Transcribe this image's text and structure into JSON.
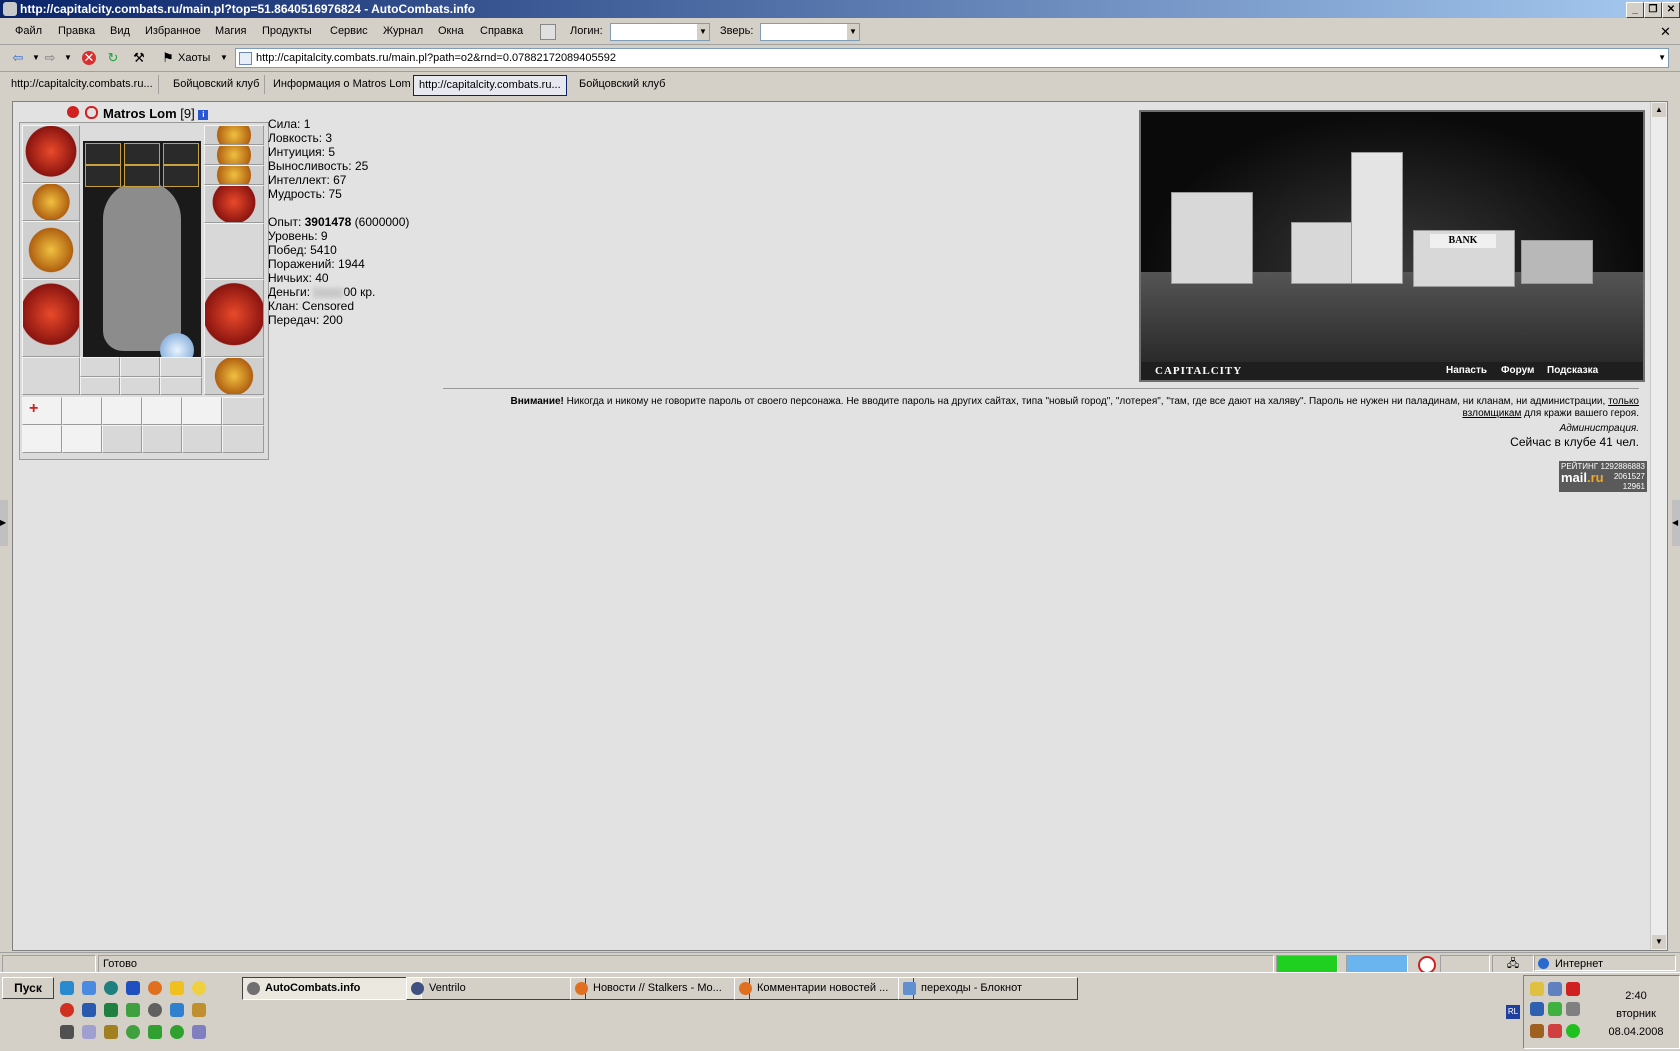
{
  "window": {
    "title": "http://capitalcity.combats.ru/main.pl?top=51.8640516976824 - AutoCombats.info"
  },
  "menu": {
    "items": [
      "Файл",
      "Правка",
      "Вид",
      "Избранное",
      "Магия",
      "Продукты",
      "Сервис",
      "Журнал",
      "Окна",
      "Справка"
    ],
    "login_label": "Логин:",
    "pet_label": "Зверь:"
  },
  "toolbar": {
    "chaos_label": "Хаоты",
    "address": "http://capitalcity.combats.ru/main.pl?path=o2&rnd=0.07882172089405592"
  },
  "tabs": [
    {
      "label": "http://capitalcity.combats.ru..."
    },
    {
      "label": "Бойцовский клуб"
    },
    {
      "label": "Информация о Matros Lom"
    },
    {
      "label": "http://capitalcity.combats.ru..."
    },
    {
      "label": "Бойцовский клуб"
    }
  ],
  "character": {
    "name": "Matros Lom",
    "level": "[9]",
    "info_badge": "i",
    "stats": [
      "Сила: 1",
      "Ловкость: 3",
      "Интуиция: 5",
      "Выносливость: 25",
      "Интеллект: 67",
      "Мудрость: 75"
    ],
    "experience_label": "Опыт: ",
    "experience_value": "3901478",
    "experience_next": " (6000000)",
    "info": [
      "Уровень: 9",
      "Побед: 5410",
      "Поражений: 1944",
      "Ничьих: 40"
    ],
    "money_label": "Деньги: ",
    "money_suffix": "00 кр.",
    "clan": "Клан: Censored",
    "transfers": "Передач: 200"
  },
  "city": {
    "brand": "CAPITALCITY",
    "bank_sign": "BANK",
    "links": [
      "Напасть",
      "Форум",
      "Подсказка"
    ]
  },
  "warning": {
    "bold": "Внимание!",
    "text_part1": " Никогда и никому не говорите пароль от своего персонажа. Не вводите пароль на других сайтах, типа \"новый город\", \"лотерея\", \"там, где все дают на халяву\". Пароль не нужен ни паладинам, ни кланам, ни администрации, ",
    "link": "только взломщикам",
    "text_part2": " для кражи вашего героя.",
    "signature": "Администрация.",
    "online": "Сейчас в клубе 41 чел."
  },
  "counter": {
    "line1": "РЕЙТИНГ",
    "n1": "1292886883",
    "n2": "2061527",
    "n3": "12961",
    "brand_a": "mail",
    "brand_b": ".ru"
  },
  "statusbar": {
    "status": "Готово",
    "zone": "Интернет"
  },
  "taskbar": {
    "start": "Пуск",
    "tasks": [
      "AutoCombats.info",
      "Ventrilo",
      "Новости // Stalkers - Mo...",
      "Комментарии новостей ...",
      "переходы - Блокнот"
    ],
    "clock_time": "2:40",
    "clock_day": "вторник",
    "clock_date": "08.04.2008",
    "lang": "RL"
  },
  "colors": {
    "title_bar_start": "#0a246a",
    "title_bar_end": "#a6caf0",
    "content_bg": "#e2e2e2",
    "chrome_bg": "#d4d0c8"
  }
}
